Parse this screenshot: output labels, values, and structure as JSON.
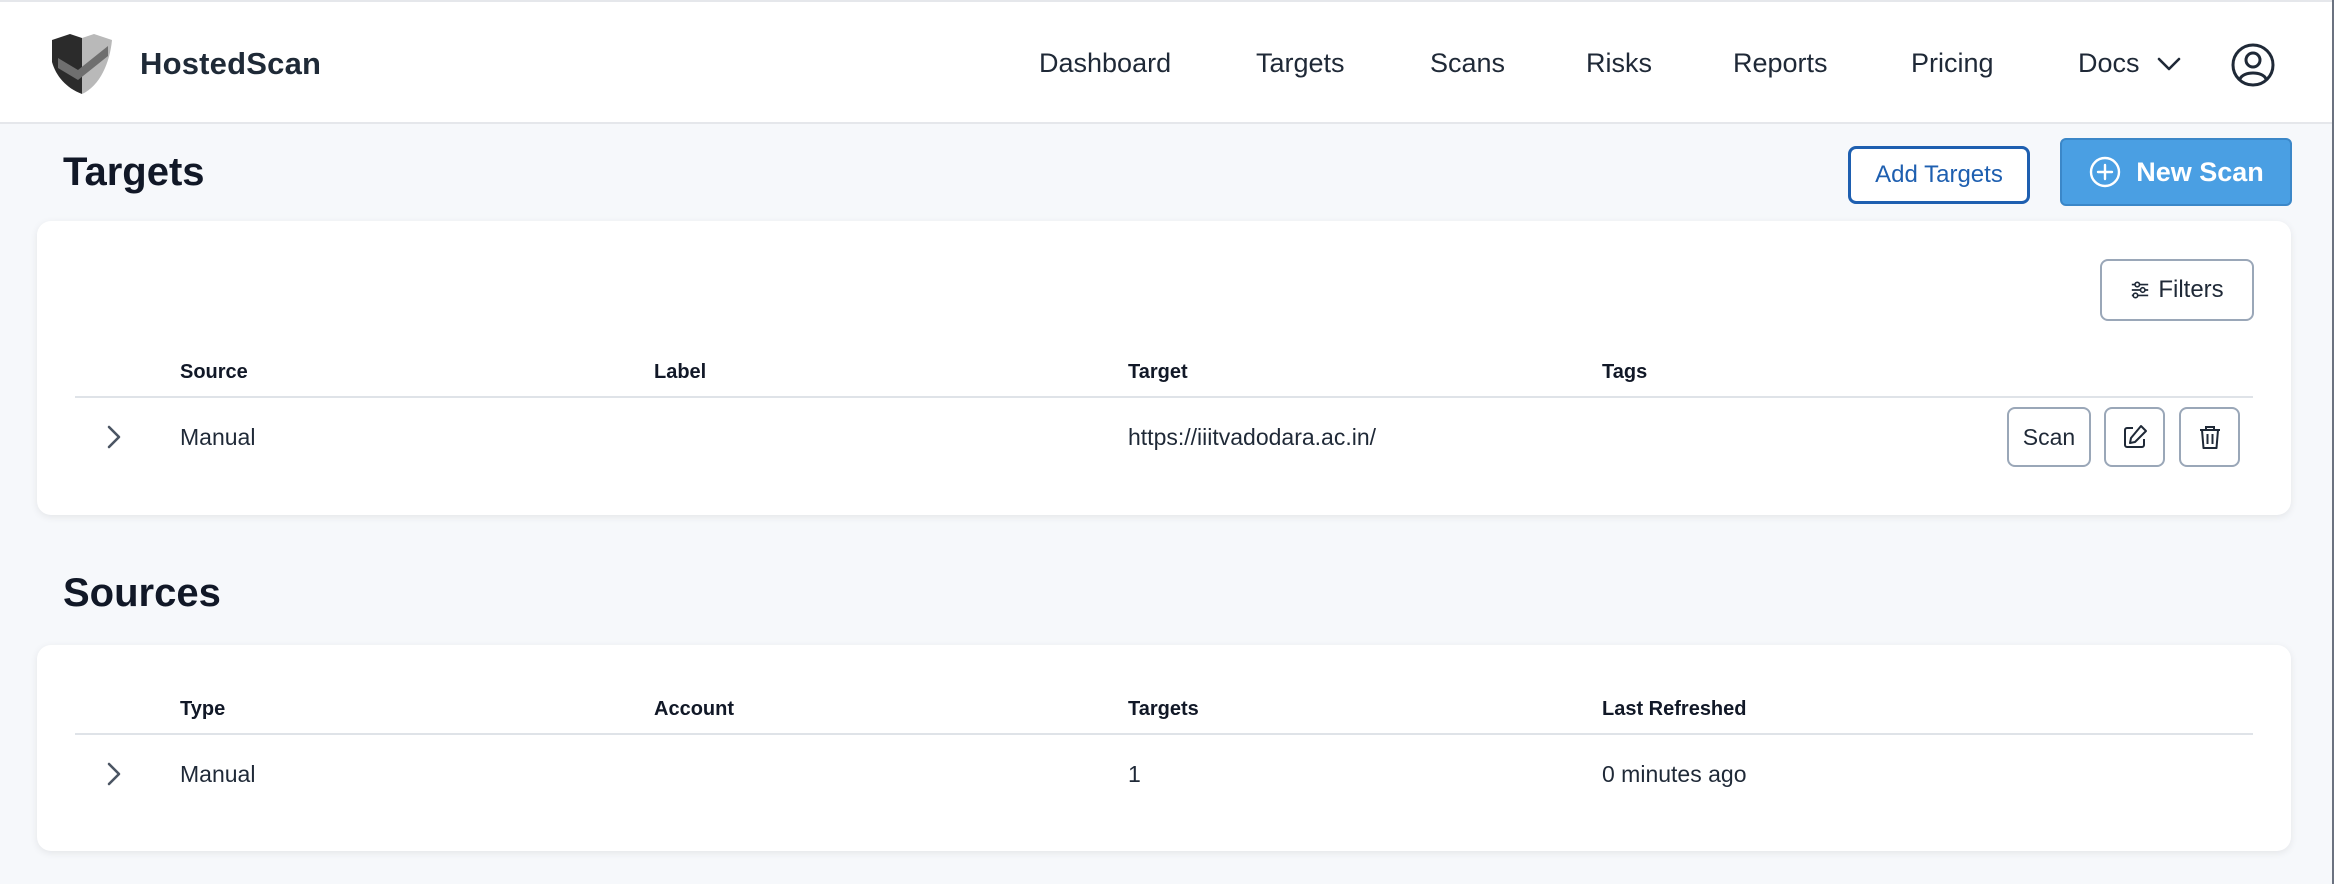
{
  "header": {
    "brand": "HostedScan",
    "nav": [
      "Dashboard",
      "Targets",
      "Scans",
      "Risks",
      "Reports",
      "Pricing",
      "Docs"
    ]
  },
  "targets_section": {
    "title": "Targets",
    "add_targets_label": "Add Targets",
    "new_scan_label": "New Scan",
    "filters_label": "Filters",
    "columns": [
      "Source",
      "Label",
      "Target",
      "Tags"
    ],
    "rows": [
      {
        "source": "Manual",
        "label": "",
        "target": "https://iiitvadodara.ac.in/",
        "tags": "",
        "scan_label": "Scan"
      }
    ]
  },
  "sources_section": {
    "title": "Sources",
    "columns": [
      "Type",
      "Account",
      "Targets",
      "Last Refreshed"
    ],
    "rows": [
      {
        "type": "Manual",
        "account": "",
        "targets": "1",
        "last_refreshed": "0 minutes ago"
      }
    ]
  },
  "colors": {
    "primary": "#4a9fe3",
    "accent": "#1e5fb0",
    "background": "#f6f8fb"
  },
  "icons": [
    "shield-logo-icon",
    "chevron-down-icon",
    "user-circle-icon",
    "plus-circle-icon",
    "sliders-icon",
    "chevron-right-icon",
    "edit-icon",
    "trash-icon"
  ]
}
